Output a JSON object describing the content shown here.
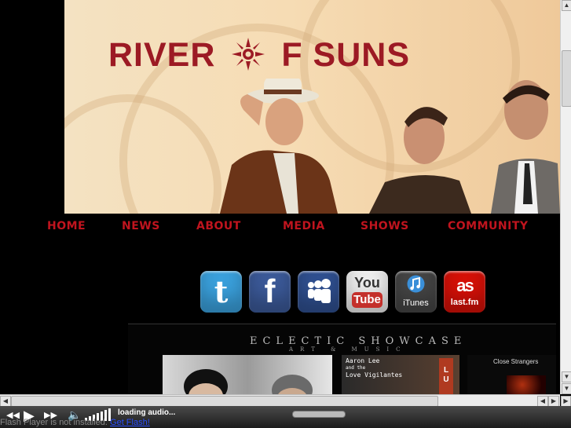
{
  "header": {
    "logo_part1": "RIVER",
    "logo_part2": "F SUNS"
  },
  "nav": {
    "items": [
      {
        "label": "HOME"
      },
      {
        "label": "NEWS"
      },
      {
        "label": "ABOUT"
      },
      {
        "label": "MEDIA"
      },
      {
        "label": "SHOWS"
      },
      {
        "label": "COMMUNITY"
      }
    ]
  },
  "social": [
    {
      "name": "twitter",
      "label": "t",
      "color": "#3aa0dc"
    },
    {
      "name": "facebook",
      "label": "f",
      "color": "#3b5998"
    },
    {
      "name": "myspace",
      "label": "",
      "color": "#2f4f8f"
    },
    {
      "name": "youtube",
      "label_top": "You",
      "label_bottom": "Tube",
      "color": "#e8e8e8"
    },
    {
      "name": "itunes",
      "label": "iTunes",
      "color": "#444444"
    },
    {
      "name": "lastfm",
      "label": "last.fm",
      "color": "#d51007"
    }
  ],
  "showcase": {
    "title": "ECLECTIC SHOWCASE",
    "subtitle": "ART & MUSIC",
    "card2_line1": "Aaron Lee",
    "card2_line2": "and the",
    "card2_line3": "Love Vigilantes",
    "card3_title": "Close Strangers"
  },
  "player": {
    "status": "loading audio...",
    "flash_notice": "Flash Player is not installed.",
    "flash_link": "Get Flash!"
  },
  "colors": {
    "brand_red": "#c0141e",
    "logo_red": "#9c1a24"
  }
}
